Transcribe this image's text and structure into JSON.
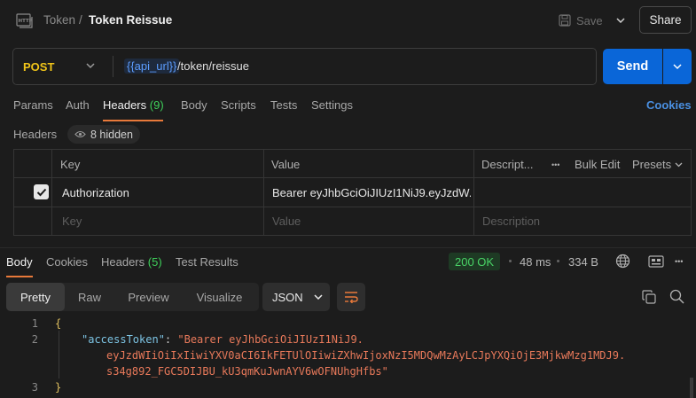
{
  "topbar": {
    "icon_text": "HTTP",
    "breadcrumb_parent": "Token",
    "breadcrumb_sep": "/",
    "breadcrumb_current": "Token Reissue",
    "save_label": "Save",
    "share_label": "Share"
  },
  "request": {
    "method": "POST",
    "url_variable": "{{api_url}}",
    "url_path": "/token/reissue",
    "send_label": "Send"
  },
  "request_tabs": [
    {
      "label": "Params"
    },
    {
      "label": "Auth"
    },
    {
      "label": "Headers",
      "count": "(9)"
    },
    {
      "label": "Body"
    },
    {
      "label": "Scripts"
    },
    {
      "label": "Tests"
    },
    {
      "label": "Settings"
    }
  ],
  "cookies_label": "Cookies",
  "headers_section": {
    "label": "Headers",
    "hidden_label": "8 hidden"
  },
  "headers_table": {
    "col_key": "Key",
    "col_value": "Value",
    "col_description": "Descript...",
    "more": "•••",
    "bulk_edit": "Bulk Edit",
    "presets": "Presets",
    "row_key": "Authorization",
    "row_value": "Bearer eyJhbGciOiJIUzI1NiJ9.eyJzdW...",
    "placeholder_key": "Key",
    "placeholder_value": "Value",
    "placeholder_description": "Description"
  },
  "response_tabs": [
    {
      "label": "Body"
    },
    {
      "label": "Cookies"
    },
    {
      "label": "Headers",
      "count": "(5)"
    },
    {
      "label": "Test Results"
    }
  ],
  "response_meta": {
    "status": "200 OK",
    "time": "48 ms",
    "size": "334 B",
    "more": "•••"
  },
  "view_tabs": [
    "Pretty",
    "Raw",
    "Preview",
    "Visualize"
  ],
  "format": "JSON",
  "code": {
    "lines": [
      "1",
      "2",
      "3"
    ],
    "open_brace": "{",
    "close_brace": "}",
    "key": "\"accessToken\"",
    "colon": ": ",
    "value_1": "\"Bearer eyJhbGciOiJIUzI1NiJ9.",
    "value_2": "eyJzdWIiOiIxIiwiYXV0aCI6IkFETUlOIiwiZXhwIjoxNzI5MDQwMzAyLCJpYXQiOjE3MjkwMzg1MDJ9.",
    "value_3": "s34g892_FGC5DIJBU_kU3qmKuJwnAYV6wOFNUhgHfbs\""
  },
  "colors": {
    "accent": "#e8793a",
    "send": "#0a66d8",
    "method": "#f0c419",
    "status_ok": "#49d466"
  }
}
